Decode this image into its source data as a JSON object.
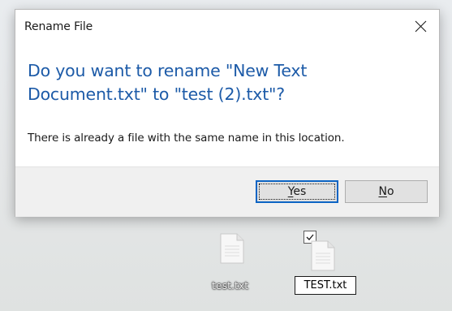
{
  "dialog": {
    "title": "Rename File",
    "instruction": "Do you want to rename \"New Text Document.txt\" to \"test (2).txt\"?",
    "message": "There is already a file with the same name in this location.",
    "buttons": {
      "yes": {
        "mnemonic": "Y",
        "rest": "es"
      },
      "no": {
        "mnemonic": "N",
        "rest": "o"
      }
    }
  },
  "desktop": {
    "files": [
      {
        "label": "test.txt"
      },
      {
        "label": "TEST.txt",
        "selected": true,
        "renaming": true
      }
    ]
  },
  "icons": {
    "close": "close-icon",
    "file": "text-file-icon",
    "checkbox": "checkmark-icon"
  },
  "colors": {
    "instruction": "#1d5ba8",
    "default_button_border": "#0c64c4",
    "footer": "#f0f0f0"
  }
}
